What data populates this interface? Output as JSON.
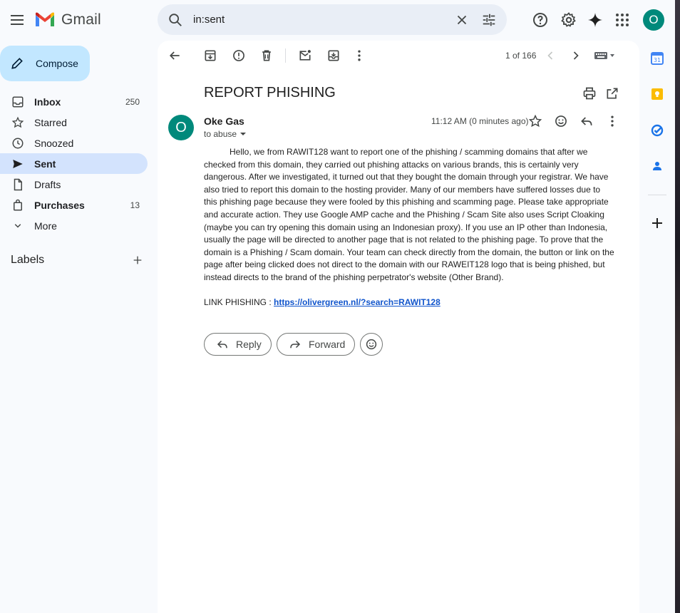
{
  "app": {
    "name": "Gmail",
    "account_initial": "O"
  },
  "search": {
    "query": "in:sent"
  },
  "compose": {
    "label": "Compose"
  },
  "nav": [
    {
      "label": "Inbox",
      "count": "250",
      "icon": "inbox-icon",
      "bold": true
    },
    {
      "label": "Starred",
      "count": "",
      "icon": "star-icon",
      "bold": false
    },
    {
      "label": "Snoozed",
      "count": "",
      "icon": "clock-icon",
      "bold": false
    },
    {
      "label": "Sent",
      "count": "",
      "icon": "send-icon",
      "bold": true,
      "active": true
    },
    {
      "label": "Drafts",
      "count": "",
      "icon": "draft-icon",
      "bold": false
    },
    {
      "label": "Purchases",
      "count": "13",
      "icon": "shopping-bag-icon",
      "bold": true
    },
    {
      "label": "More",
      "count": "",
      "icon": "chevron-down-icon",
      "bold": false
    }
  ],
  "labels": {
    "heading": "Labels"
  },
  "toolbar": {
    "pager": "1 of 166"
  },
  "message": {
    "subject": "REPORT PHISHING",
    "sender_initial": "O",
    "sender_name": "Oke Gas",
    "recipient": "to abuse",
    "time": "11:12 AM (0 minutes ago)",
    "body": "Hello, we from RAWIT128 want to report one of the phishing / scamming domains that after we checked from this domain, they carried out phishing attacks on various brands, this is certainly very dangerous. After we investigated, it turned out that they bought the domain through your registrar. We have also tried to report this domain to the hosting provider. Many of our members have suffered losses due to this phishing page because they were fooled by this phishing and scamming page. Please take appropriate and accurate action. They use Google AMP cache and the Phishing / Scam Site also uses Script Cloaking (maybe you can try opening this domain using an Indonesian proxy). If you use an IP other than Indonesia, usually the page will be directed to another page that is not related to the phishing page. To prove that the domain is a Phishing / Scam domain. Your team can check directly from the domain, the button or link on the page after being clicked does not direct to the domain with our RAWEIT128 logo that is being phished, but instead directs to the brand of the phishing perpetrator's website (Other Brand).",
    "link_label": "LINK PHISHING : ",
    "link_url": "https://olivergreen.nl/?search=RAWIT128"
  },
  "actions": {
    "reply": "Reply",
    "forward": "Forward"
  },
  "colors": {
    "brand_blue": "#c2e7ff",
    "active_nav": "#d3e3fd",
    "avatar": "#00897b",
    "link": "#1155cc"
  }
}
